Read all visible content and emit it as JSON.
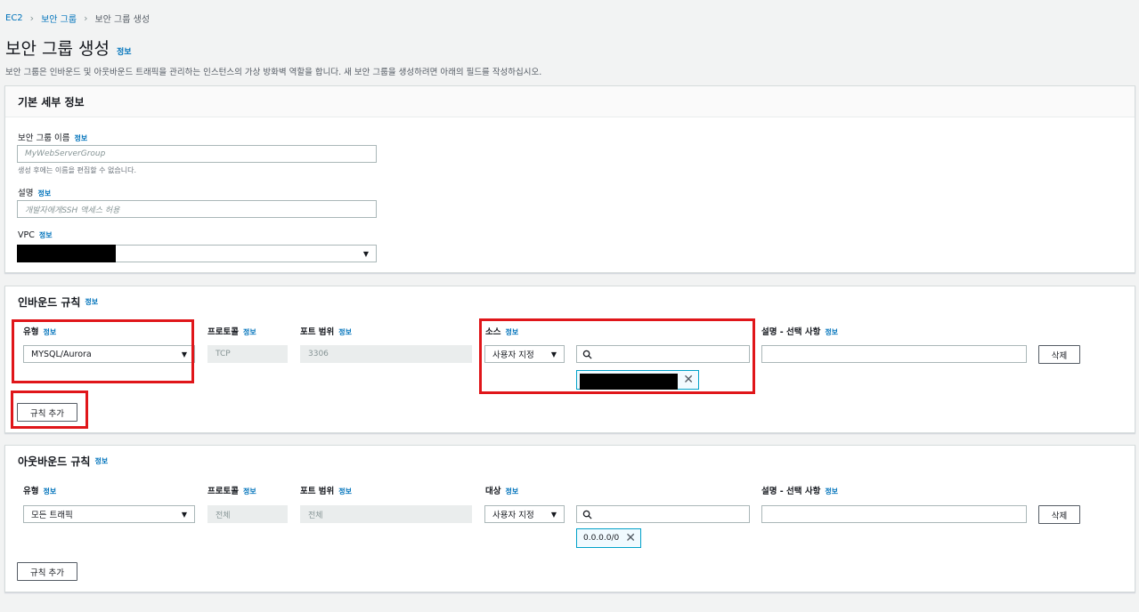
{
  "breadcrumb": {
    "items": [
      "EC2",
      "보안 그룹",
      "보안 그룹 생성"
    ]
  },
  "page": {
    "title": "보안 그룹 생성",
    "info": "정보",
    "subtitle": "보안 그룹은 인바운드 및 아웃바운드 트래픽을 관리하는 인스턴스의 가상 방화벽 역할을 합니다. 새 보안 그룹을 생성하려면 아래의 필드를 작성하십시오."
  },
  "basic": {
    "heading": "기본 세부 정보",
    "name_label": "보안 그룹 이름",
    "name_placeholder": "MyWebServerGroup",
    "name_hint": "생성 후에는 이름을 편집할 수 없습니다.",
    "desc_label": "설명",
    "desc_placeholder": "개발자에게SSH 액세스 허용",
    "vpc_label": "VPC",
    "info": "정보"
  },
  "inbound": {
    "heading": "인바운드 규칙",
    "info": "정보",
    "col_type": "유형",
    "col_protocol": "프로토콜",
    "col_port": "포트 범위",
    "col_source": "소스",
    "col_desc": "설명 - 선택 사항",
    "type_value": "MYSQL/Aurora",
    "protocol_value": "TCP",
    "port_value": "3306",
    "source_mode": "사용자 지정",
    "delete_label": "삭제",
    "add_rule_label": "규칙 추가"
  },
  "outbound": {
    "heading": "아웃바운드 규칙",
    "info": "정보",
    "col_type": "유형",
    "col_protocol": "프로토콜",
    "col_port": "포트 범위",
    "col_dest": "대상",
    "col_desc": "설명 - 선택 사항",
    "type_value": "모든 트래픽",
    "protocol_value": "전체",
    "port_value": "전체",
    "dest_mode": "사용자 지정",
    "cidr_token": "0.0.0.0/0",
    "delete_label": "삭제",
    "add_rule_label": "규칙 추가"
  },
  "icons": {
    "search": "search-icon",
    "close": "close-icon",
    "caret": "caret-down-icon",
    "chevron": "chevron-right-icon"
  },
  "colors": {
    "link": "#0073bb",
    "highlight": "#e0161a",
    "token_border": "#00a1c9"
  }
}
